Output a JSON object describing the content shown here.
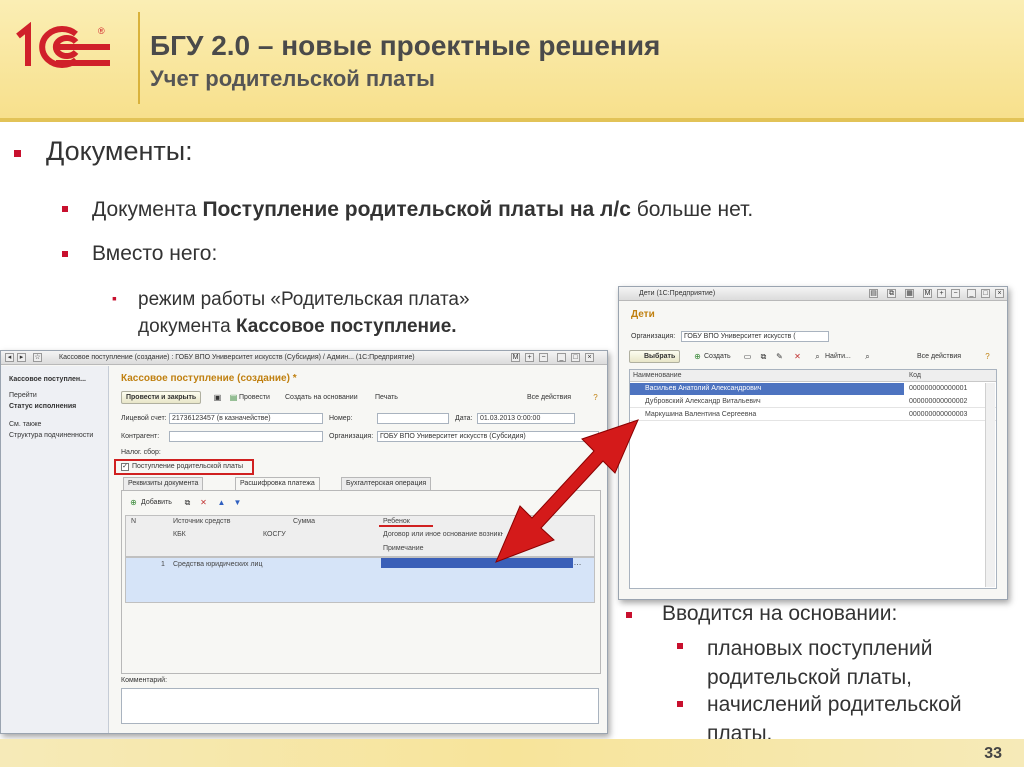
{
  "slide": {
    "title": "БГУ 2.0 – новые проектные решения",
    "subtitle": "Учет родительской платы",
    "page_number": "33",
    "logo_text": "1С",
    "bullet1": "Документы:",
    "b2a_pre": "Документа ",
    "b2a_bold": "Поступление родительской платы на л/с",
    "b2a_post": " больше нет.",
    "b2b": "Вместо него:",
    "b3_line1": "режим работы «Родительская плата»",
    "b3_line2_pre": "документа ",
    "b3_line2_bold": "Кассовое поступление.",
    "r1": "Вводится на основании:",
    "r2_line1": "плановых поступлений",
    "r2_line2": "родительской платы,",
    "r3_line1": "начислений родительской",
    "r3_line2": "платы.",
    "colors": {
      "accent": "#c8102e",
      "header_bg": "#f9e8a0",
      "selection": "#4d73c0"
    }
  },
  "kassa_window": {
    "title": "Кассовое поступление (создание) : ГОБУ ВПО Университет искусств (Субсидия) / Админ... (1С:Предприятие)",
    "sidebar": [
      "Кассовое поступлен...",
      "Перейти",
      "Статус исполнения",
      "См. также",
      "Структура подчиненности"
    ],
    "heading": "Кассовое поступление (создание) *",
    "toolbar": {
      "post_close": "Провести и закрыть",
      "post": "Провести",
      "create_basis": "Создать на основании",
      "print": "Печать",
      "all_actions": "Все действия"
    },
    "fields": {
      "account_label": "Лицевой счет:",
      "account_value": "21736123457 (в казначействе)",
      "number_label": "Номер:",
      "number_value": "",
      "date_label": "Дата:",
      "date_value": "01.03.2013  0:00:00",
      "contractor_label": "Контрагент:",
      "contractor_value": "",
      "org_label": "Организация:",
      "org_value": "ГОБУ ВПО Университет искусств (Субсидия)",
      "fee_label": "Налог. сбор:",
      "checkbox_label": "Поступление родительской платы"
    },
    "tabs": [
      "Реквизиты документа",
      "Расшифровка платежа",
      "Бухгалтерская операция"
    ],
    "add_label": "Добавить",
    "table_headers": [
      "N",
      "Источник средств",
      "Сумма",
      "Ребенок",
      "КБК",
      "КОСГУ",
      "Договор или иное основание возникн",
      "Примечание"
    ],
    "row": {
      "n": "1",
      "source": "Средства юридических лиц"
    },
    "comment_label": "Комментарий:"
  },
  "deti_window": {
    "title": "Дети  (1С:Предприятие)",
    "heading": "Дети",
    "org_label": "Организация:",
    "org_value": "ГОБУ ВПО Университет искусств (",
    "toolbar": {
      "select": "Выбрать",
      "create": "Создать",
      "find": "Найти...",
      "all_actions": "Все действия"
    },
    "columns": [
      "Наименование",
      "Код"
    ],
    "rows": [
      {
        "name": "Васильев Анатолий Александрович",
        "code": "000000000000001"
      },
      {
        "name": "Дубровский Александр Витальевич",
        "code": "000000000000002"
      },
      {
        "name": "Маркушина Валентина Сергеевна",
        "code": "000000000000003"
      }
    ]
  }
}
